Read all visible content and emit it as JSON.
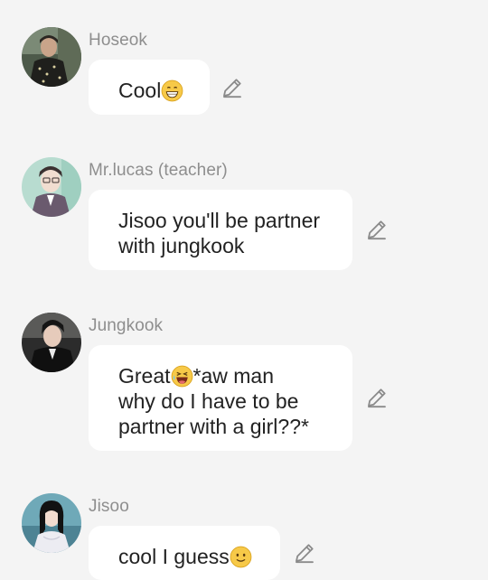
{
  "messages": [
    {
      "sender": "Hoseok",
      "avatar": "hoseok-avatar",
      "lines": [
        "Cool"
      ],
      "emoji": "grinning-emoji"
    },
    {
      "sender": "Mr.lucas (teacher)",
      "avatar": "mr-lucas-avatar",
      "lines": [
        "Jisoo you'll be partner",
        "with jungkook"
      ]
    },
    {
      "sender": "Jungkook",
      "avatar": "jungkook-avatar",
      "lines": [
        "Great",
        "*aw man",
        "why do I have to be",
        "partner with a girl??*"
      ],
      "emoji": "laughing-emoji"
    },
    {
      "sender": "Jisoo",
      "avatar": "jisoo-avatar",
      "lines": [
        "cool I guess"
      ],
      "emoji": "smiling-emoji"
    }
  ],
  "icons": {
    "edit": "pencil-edit-icon"
  },
  "colors": {
    "background": "#f4f4f4",
    "bubble": "#ffffff",
    "sender": "#8e8e8e",
    "text": "#222222",
    "emoji": "#f7c948"
  }
}
